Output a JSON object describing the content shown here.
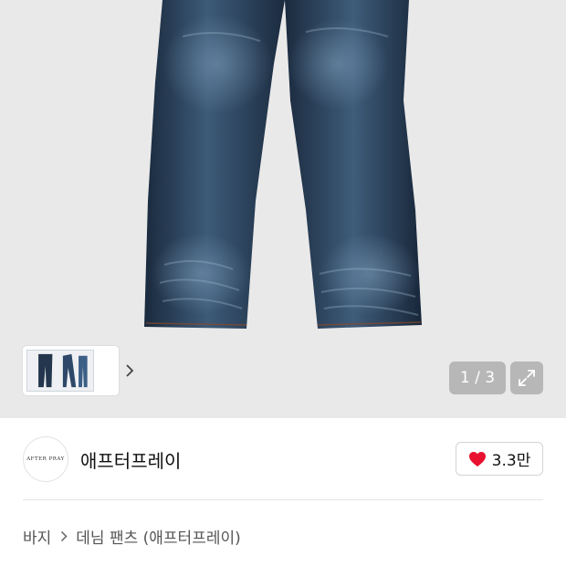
{
  "gallery": {
    "counter": "1 / 3",
    "icons": {
      "thumbnail_next": "chevron-right-icon",
      "expand": "expand-arrows-icon"
    }
  },
  "shop": {
    "logo_text": "AFTER PRAY",
    "name": "애프터프레이",
    "likes": "3.3만",
    "heart_color": "#e8102e"
  },
  "breadcrumb": {
    "category": "바지",
    "product": "데님 팬츠 (애프터프레이)"
  }
}
